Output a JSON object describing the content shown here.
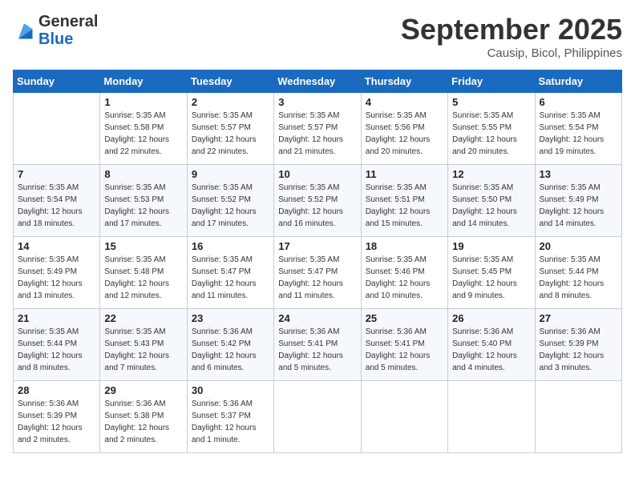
{
  "header": {
    "logo_line1": "General",
    "logo_line2": "Blue",
    "month": "September 2025",
    "location": "Causip, Bicol, Philippines"
  },
  "weekdays": [
    "Sunday",
    "Monday",
    "Tuesday",
    "Wednesday",
    "Thursday",
    "Friday",
    "Saturday"
  ],
  "weeks": [
    [
      {
        "day": "",
        "info": ""
      },
      {
        "day": "1",
        "info": "Sunrise: 5:35 AM\nSunset: 5:58 PM\nDaylight: 12 hours\nand 22 minutes."
      },
      {
        "day": "2",
        "info": "Sunrise: 5:35 AM\nSunset: 5:57 PM\nDaylight: 12 hours\nand 22 minutes."
      },
      {
        "day": "3",
        "info": "Sunrise: 5:35 AM\nSunset: 5:57 PM\nDaylight: 12 hours\nand 21 minutes."
      },
      {
        "day": "4",
        "info": "Sunrise: 5:35 AM\nSunset: 5:56 PM\nDaylight: 12 hours\nand 20 minutes."
      },
      {
        "day": "5",
        "info": "Sunrise: 5:35 AM\nSunset: 5:55 PM\nDaylight: 12 hours\nand 20 minutes."
      },
      {
        "day": "6",
        "info": "Sunrise: 5:35 AM\nSunset: 5:54 PM\nDaylight: 12 hours\nand 19 minutes."
      }
    ],
    [
      {
        "day": "7",
        "info": "Sunrise: 5:35 AM\nSunset: 5:54 PM\nDaylight: 12 hours\nand 18 minutes."
      },
      {
        "day": "8",
        "info": "Sunrise: 5:35 AM\nSunset: 5:53 PM\nDaylight: 12 hours\nand 17 minutes."
      },
      {
        "day": "9",
        "info": "Sunrise: 5:35 AM\nSunset: 5:52 PM\nDaylight: 12 hours\nand 17 minutes."
      },
      {
        "day": "10",
        "info": "Sunrise: 5:35 AM\nSunset: 5:52 PM\nDaylight: 12 hours\nand 16 minutes."
      },
      {
        "day": "11",
        "info": "Sunrise: 5:35 AM\nSunset: 5:51 PM\nDaylight: 12 hours\nand 15 minutes."
      },
      {
        "day": "12",
        "info": "Sunrise: 5:35 AM\nSunset: 5:50 PM\nDaylight: 12 hours\nand 14 minutes."
      },
      {
        "day": "13",
        "info": "Sunrise: 5:35 AM\nSunset: 5:49 PM\nDaylight: 12 hours\nand 14 minutes."
      }
    ],
    [
      {
        "day": "14",
        "info": "Sunrise: 5:35 AM\nSunset: 5:49 PM\nDaylight: 12 hours\nand 13 minutes."
      },
      {
        "day": "15",
        "info": "Sunrise: 5:35 AM\nSunset: 5:48 PM\nDaylight: 12 hours\nand 12 minutes."
      },
      {
        "day": "16",
        "info": "Sunrise: 5:35 AM\nSunset: 5:47 PM\nDaylight: 12 hours\nand 11 minutes."
      },
      {
        "day": "17",
        "info": "Sunrise: 5:35 AM\nSunset: 5:47 PM\nDaylight: 12 hours\nand 11 minutes."
      },
      {
        "day": "18",
        "info": "Sunrise: 5:35 AM\nSunset: 5:46 PM\nDaylight: 12 hours\nand 10 minutes."
      },
      {
        "day": "19",
        "info": "Sunrise: 5:35 AM\nSunset: 5:45 PM\nDaylight: 12 hours\nand 9 minutes."
      },
      {
        "day": "20",
        "info": "Sunrise: 5:35 AM\nSunset: 5:44 PM\nDaylight: 12 hours\nand 8 minutes."
      }
    ],
    [
      {
        "day": "21",
        "info": "Sunrise: 5:35 AM\nSunset: 5:44 PM\nDaylight: 12 hours\nand 8 minutes."
      },
      {
        "day": "22",
        "info": "Sunrise: 5:35 AM\nSunset: 5:43 PM\nDaylight: 12 hours\nand 7 minutes."
      },
      {
        "day": "23",
        "info": "Sunrise: 5:36 AM\nSunset: 5:42 PM\nDaylight: 12 hours\nand 6 minutes."
      },
      {
        "day": "24",
        "info": "Sunrise: 5:36 AM\nSunset: 5:41 PM\nDaylight: 12 hours\nand 5 minutes."
      },
      {
        "day": "25",
        "info": "Sunrise: 5:36 AM\nSunset: 5:41 PM\nDaylight: 12 hours\nand 5 minutes."
      },
      {
        "day": "26",
        "info": "Sunrise: 5:36 AM\nSunset: 5:40 PM\nDaylight: 12 hours\nand 4 minutes."
      },
      {
        "day": "27",
        "info": "Sunrise: 5:36 AM\nSunset: 5:39 PM\nDaylight: 12 hours\nand 3 minutes."
      }
    ],
    [
      {
        "day": "28",
        "info": "Sunrise: 5:36 AM\nSunset: 5:39 PM\nDaylight: 12 hours\nand 2 minutes."
      },
      {
        "day": "29",
        "info": "Sunrise: 5:36 AM\nSunset: 5:38 PM\nDaylight: 12 hours\nand 2 minutes."
      },
      {
        "day": "30",
        "info": "Sunrise: 5:36 AM\nSunset: 5:37 PM\nDaylight: 12 hours\nand 1 minute."
      },
      {
        "day": "",
        "info": ""
      },
      {
        "day": "",
        "info": ""
      },
      {
        "day": "",
        "info": ""
      },
      {
        "day": "",
        "info": ""
      }
    ]
  ]
}
